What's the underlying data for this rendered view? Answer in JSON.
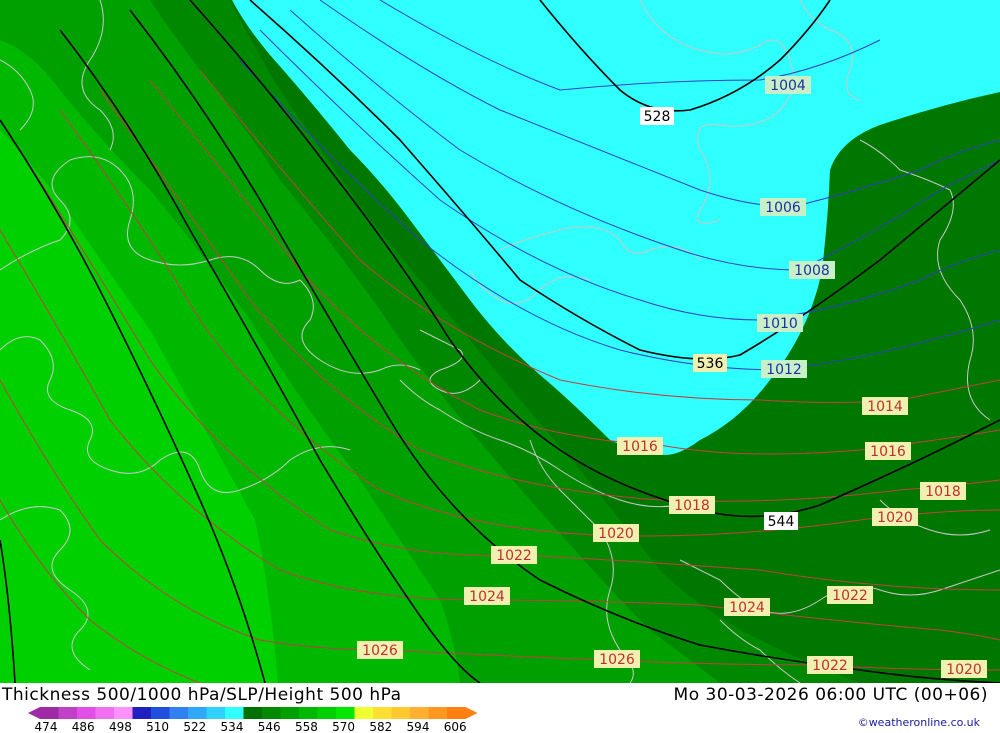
{
  "footer": {
    "title": "Thickness 500/1000 hPa/SLP/Height 500 hPa",
    "datetime": "Mo 30-03-2026 06:00 UTC (00+06)",
    "credit": "©weatheronline.co.uk"
  },
  "legend": {
    "colors": [
      "#9e2aa6",
      "#c040c8",
      "#e050e8",
      "#f070f0",
      "#ff90ff",
      "#2020c0",
      "#2050e0",
      "#3080f0",
      "#30a8f8",
      "#30d0ff",
      "#30ffff",
      "#007000",
      "#008800",
      "#00a000",
      "#00b800",
      "#00d000",
      "#00e800",
      "#f0ff30",
      "#ffe030",
      "#ffc830",
      "#ffb030",
      "#ff9820",
      "#ff8010"
    ],
    "labels": [
      "474",
      "486",
      "498",
      "510",
      "522",
      "534",
      "546",
      "558",
      "570",
      "582",
      "594",
      "606"
    ]
  },
  "map": {
    "isobar_labels": [
      "1004",
      "1006",
      "1008",
      "1010",
      "1012",
      "1014",
      "1016",
      "1016",
      "1018",
      "1018",
      "1020",
      "1020",
      "1020",
      "1022",
      "1022",
      "1022",
      "1024",
      "1024",
      "1026",
      "1026"
    ],
    "height_labels": [
      "528",
      "536",
      "544"
    ]
  }
}
